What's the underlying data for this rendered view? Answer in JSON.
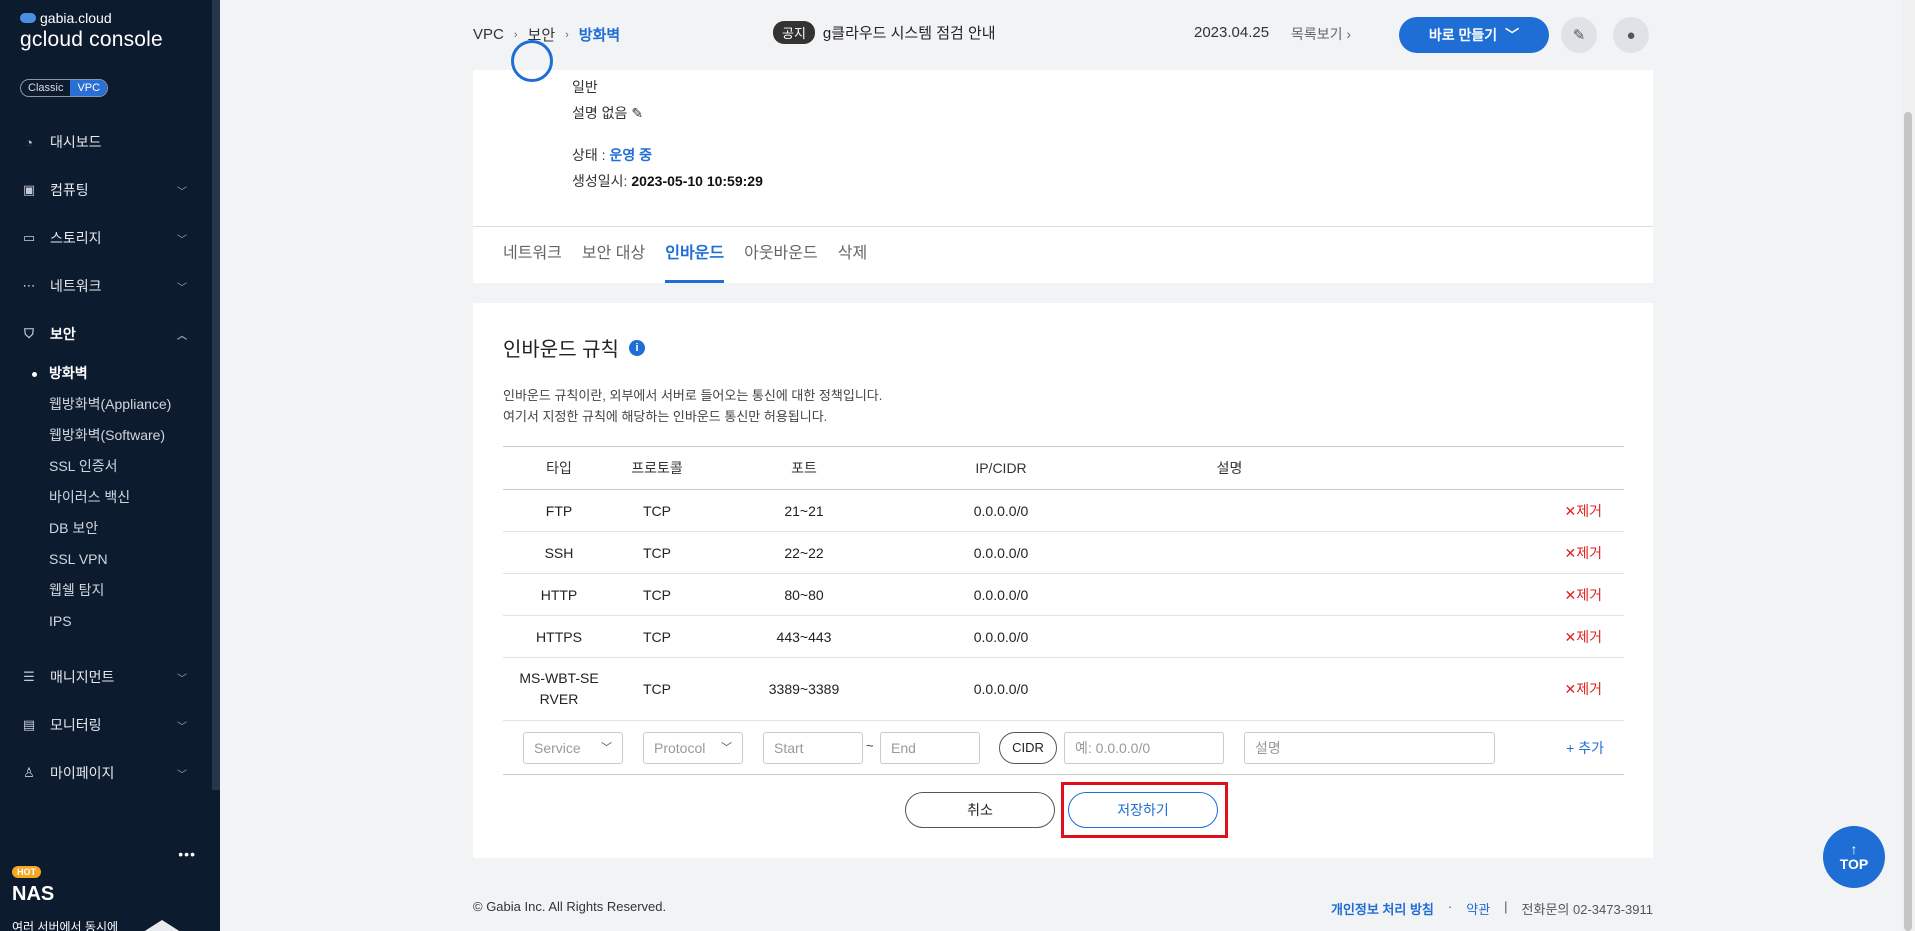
{
  "sidebar": {
    "brand": "gabia.cloud",
    "console": "gcloud console",
    "switch": [
      "Classic",
      "VPC"
    ],
    "menu": [
      {
        "label": "대시보드",
        "icon": "gauge-icon"
      },
      {
        "label": "컴퓨팅",
        "icon": "chip-icon"
      },
      {
        "label": "스토리지",
        "icon": "storage-icon"
      },
      {
        "label": "네트워크",
        "icon": "network-icon"
      },
      {
        "label": "보안",
        "icon": "shield-icon"
      }
    ],
    "security_items": [
      "방화벽",
      "웹방화벽(Appliance)",
      "웹방화벽(Software)",
      "SSL 인증서",
      "바이러스 백신",
      "DB 보안",
      "SSL VPN",
      "웹쉘 탐지",
      "IPS"
    ],
    "menu2": [
      {
        "label": "매니지먼트",
        "icon": "management-icon"
      },
      {
        "label": "모니터링",
        "icon": "monitor-icon"
      },
      {
        "label": "마이페이지",
        "icon": "user-icon"
      }
    ],
    "promo": {
      "badge": "HOT",
      "title": "NAS",
      "desc": "여러 서버에서 동시에"
    }
  },
  "header": {
    "breadcrumb": [
      "VPC",
      "보안",
      "방화벽"
    ],
    "notice_tag": "공지",
    "notice_text": "g클라우드 시스템 점검 안내",
    "notice_date": "2023.04.25",
    "notice_list": "목록보기",
    "make_button": "바로 만들기"
  },
  "detail": {
    "type": "일반",
    "description": "설명 없음",
    "status_label": "상태 : ",
    "status_value": "운영 중",
    "created_label": "생성일시: ",
    "created_value": "2023-05-10 10:59:29"
  },
  "tabs": [
    "네트워크",
    "보안 대상",
    "인바운드",
    "아웃바운드",
    "삭제"
  ],
  "rules": {
    "title": "인바운드 규칙",
    "desc1": "인바운드 규칙이란, 외부에서 서버로 들어오는 통신에 대한 정책입니다.",
    "desc2": "여기서 지정한 규칙에 해당하는 인바운드 통신만 허용됩니다.",
    "columns": [
      "타입",
      "프로토콜",
      "포트",
      "IP/CIDR",
      "설명"
    ],
    "rows": [
      {
        "type": "FTP",
        "protocol": "TCP",
        "port": "21~21",
        "cidr": "0.0.0.0/0",
        "desc": ""
      },
      {
        "type": "SSH",
        "protocol": "TCP",
        "port": "22~22",
        "cidr": "0.0.0.0/0",
        "desc": ""
      },
      {
        "type": "HTTP",
        "protocol": "TCP",
        "port": "80~80",
        "cidr": "0.0.0.0/0",
        "desc": ""
      },
      {
        "type": "HTTPS",
        "protocol": "TCP",
        "port": "443~443",
        "cidr": "0.0.0.0/0",
        "desc": ""
      },
      {
        "type": "MS-WBT-SERVER",
        "protocol": "TCP",
        "port": "3389~3389",
        "cidr": "0.0.0.0/0",
        "desc": ""
      }
    ],
    "remove_label": "✕제거",
    "add": {
      "service_placeholder": "Service",
      "protocol_placeholder": "Protocol",
      "start_placeholder": "Start",
      "tilde": "~",
      "end_placeholder": "End",
      "cidr_button": "CIDR",
      "ip_placeholder": "예: 0.0.0.0/0",
      "desc_placeholder": "설명",
      "add_link": "+ 추가"
    },
    "cancel": "취소",
    "save": "저장하기"
  },
  "footer": {
    "copyright": "© Gabia Inc. All Rights Reserved.",
    "privacy": "개인정보 처리 방침",
    "terms": "약관",
    "contact": "전화문의  02-3473-3911"
  },
  "top_button": "TOP"
}
